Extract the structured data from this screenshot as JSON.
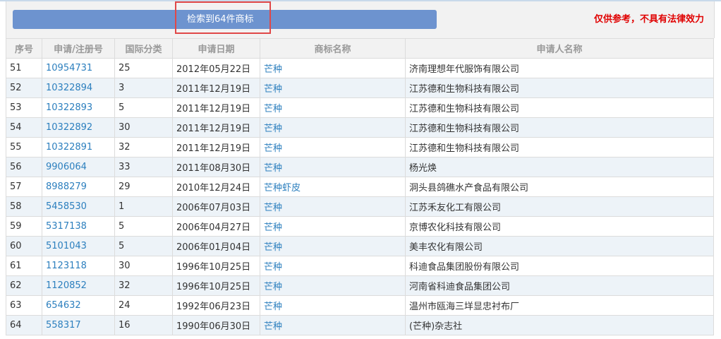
{
  "header": {
    "result_label": "检索到64件商标",
    "disclaimer": "仅供参考，不具有法律效力"
  },
  "table": {
    "columns": [
      "序号",
      "申请/注册号",
      "国际分类",
      "申请日期",
      "商标名称",
      "申请人名称"
    ],
    "rows": [
      {
        "no": "51",
        "reg": "10954731",
        "cls": "25",
        "date": "2012年05月22日",
        "mark": "芒种",
        "applicant": "济南理想年代服饰有限公司"
      },
      {
        "no": "52",
        "reg": "10322894",
        "cls": "3",
        "date": "2011年12月19日",
        "mark": "芒种",
        "applicant": "江苏德和生物科技有限公司"
      },
      {
        "no": "53",
        "reg": "10322893",
        "cls": "5",
        "date": "2011年12月19日",
        "mark": "芒种",
        "applicant": "江苏德和生物科技有限公司"
      },
      {
        "no": "54",
        "reg": "10322892",
        "cls": "30",
        "date": "2011年12月19日",
        "mark": "芒种",
        "applicant": "江苏德和生物科技有限公司"
      },
      {
        "no": "55",
        "reg": "10322891",
        "cls": "32",
        "date": "2011年12月19日",
        "mark": "芒种",
        "applicant": "江苏德和生物科技有限公司"
      },
      {
        "no": "56",
        "reg": "9906064",
        "cls": "33",
        "date": "2011年08月30日",
        "mark": "芒种",
        "applicant": "杨光焕"
      },
      {
        "no": "57",
        "reg": "8988279",
        "cls": "29",
        "date": "2010年12月24日",
        "mark": "芒种虾皮",
        "applicant": "洞头县鸽礁水产食品有限公司"
      },
      {
        "no": "58",
        "reg": "5458530",
        "cls": "1",
        "date": "2006年07月03日",
        "mark": "芒种",
        "applicant": "江苏禾友化工有限公司"
      },
      {
        "no": "59",
        "reg": "5317138",
        "cls": "5",
        "date": "2006年04月27日",
        "mark": "芒种",
        "applicant": "京博农化科技有限公司"
      },
      {
        "no": "60",
        "reg": "5101043",
        "cls": "5",
        "date": "2006年01月04日",
        "mark": "芒种",
        "applicant": "美丰农化有限公司"
      },
      {
        "no": "61",
        "reg": "1123118",
        "cls": "30",
        "date": "1996年10月25日",
        "mark": "芒种",
        "applicant": "科迪食品集团股份有限公司"
      },
      {
        "no": "62",
        "reg": "1120852",
        "cls": "32",
        "date": "1996年10月25日",
        "mark": "芒种",
        "applicant": "河南省科迪食品集团公司"
      },
      {
        "no": "63",
        "reg": "654632",
        "cls": "24",
        "date": "1992年06月23日",
        "mark": "芒种",
        "applicant": "温州市瓯海三垟显忠衬布厂"
      },
      {
        "no": "64",
        "reg": "558317",
        "cls": "16",
        "date": "1990年06月30日",
        "mark": "芒种",
        "applicant": "(芒种)杂志社"
      }
    ]
  }
}
